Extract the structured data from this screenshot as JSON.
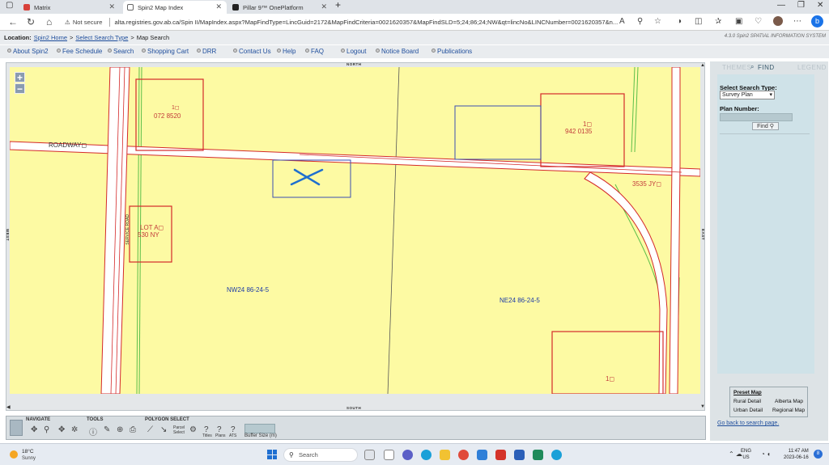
{
  "browser": {
    "tabs": [
      {
        "label": "Matrix",
        "active": false
      },
      {
        "label": "Spin2 Map Index",
        "active": true
      },
      {
        "label": "Pillar 9™ OnePlatform",
        "active": false
      }
    ],
    "not_secure": "Not secure",
    "url": "alta.registries.gov.ab.ca/Spin II/MapIndex.aspx?MapFindType=LincGuid=2172&MapFindCriteria=0021620357&MapFindSLD=5;24;86;24;NW&qt=lincNo&LINCNumber=0021620357&n..."
  },
  "location": {
    "label": "Location:",
    "home": "Spin2 Home",
    "sep1": ">",
    "search_type": "Select Search Type",
    "sep2": ">",
    "current": "Map Search",
    "version": "4.3.0 Spin2 SPATIAL INFORMATION SYSTEM"
  },
  "menu": [
    "About Spin2",
    "Fee Schedule",
    "Search",
    "Shopping Cart",
    "DRR",
    "Contact Us",
    "Help",
    "FAQ",
    "Logout",
    "Notice Board",
    "Publications"
  ],
  "map": {
    "compass": {
      "north": "NORTH",
      "south": "SOUTH",
      "east": "EAST",
      "west": "WEST"
    },
    "zoom_in": "+",
    "zoom_out": "−",
    "labels": {
      "parcel_072_num": "1◻",
      "parcel_072_plan": "072 8520",
      "parcel_942_num": "1◻",
      "parcel_942_plan": "942 0135",
      "roadway": "ROADWAY◻",
      "plan_3535": "3535 JY◻",
      "lot_a": "LOT A◻",
      "lot_a_plan": "530 NY",
      "service_road": "SERVICE ROAD",
      "nw24": "NW24 86-24-5",
      "ne24": "NE24 86-24-5",
      "parcel_bottom_num": "1◻"
    }
  },
  "tools": {
    "navigate": "NAVIGATE",
    "tools": "TOOLS",
    "polygon_select": "POLYGON SELECT",
    "parcel_select": "Parcel\nSelect",
    "titles": "Titles",
    "plans": "Plans",
    "atlas": "ATS",
    "buffer_size": "Buffer Size (m)"
  },
  "panel": {
    "tabs": {
      "themes": "THEMES",
      "find": "FIND",
      "legend": "LEGEND"
    },
    "select_search_type_label": "Select Search Type:",
    "search_type_value": "Survey Plan",
    "plan_number_label": "Plan Number:",
    "plan_number_value": "",
    "find_button": "Find",
    "preset_map": "Preset Map",
    "rural_detail": "Rural Detail",
    "alberta_map": "Alberta Map",
    "urban_detail": "Urban Detail",
    "regional_map": "Regional Map",
    "back_link": "Go back to search page."
  },
  "taskbar": {
    "temperature": "18°C",
    "condition": "Sunny",
    "search": "Search",
    "lang_line1": "ENG",
    "lang_line2": "US",
    "time": "11:47 AM",
    "date": "2023-06-16"
  },
  "colors": {
    "map_fill": "#fdfaa3",
    "parcel_red": "#d42a2a",
    "parcel_blue": "#3a4fb0",
    "road_white": "#ffffff",
    "creek_green": "#5cbf4a",
    "marker_blue": "#1f6fcf"
  }
}
